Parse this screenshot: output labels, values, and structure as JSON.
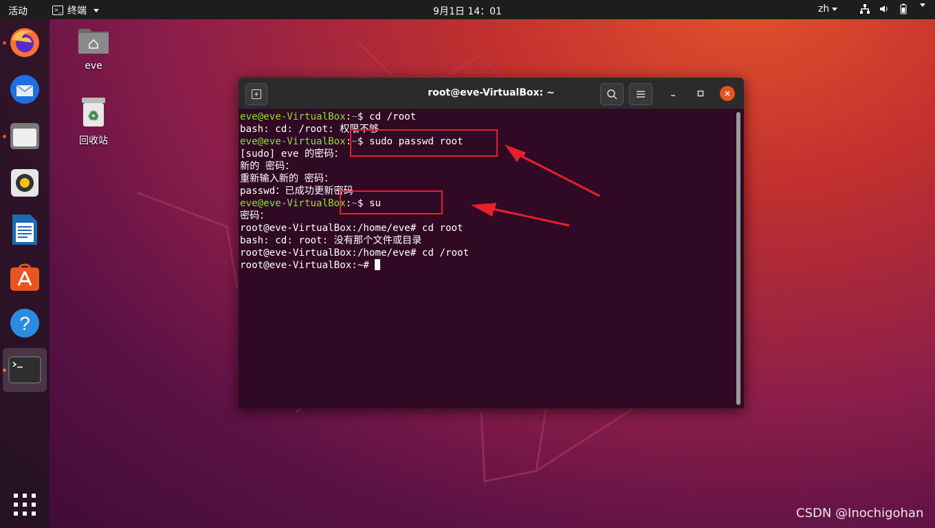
{
  "topbar": {
    "activities": "活动",
    "app_name": "终端",
    "clock": "9月1日  14：01",
    "lang": "zh"
  },
  "dock": {
    "items": [
      {
        "icon": "firefox-icon",
        "running": true
      },
      {
        "icon": "thunderbird-icon",
        "running": false
      },
      {
        "icon": "files-icon",
        "running": true
      },
      {
        "icon": "rhythmbox-icon",
        "running": false
      },
      {
        "icon": "libreoffice-writer-icon",
        "running": false
      },
      {
        "icon": "software-center-icon",
        "running": false
      },
      {
        "icon": "help-icon",
        "running": false
      },
      {
        "icon": "terminal-icon",
        "running": true
      }
    ],
    "show_apps_icon": "app-grid-icon"
  },
  "desktop": {
    "home_label": "eve",
    "trash_label": "回收站"
  },
  "terminal": {
    "title": "root@eve-VirtualBox: ~",
    "lines": [
      {
        "user": "eve@eve-VirtualBox",
        "path": "~",
        "sym": "$ ",
        "text": "cd /root"
      },
      {
        "text": "bash: cd: /root: 权限不够"
      },
      {
        "user": "eve@eve-VirtualBox",
        "path": "~",
        "sym": "$ ",
        "text": "sudo passwd root"
      },
      {
        "text": "[sudo] eve 的密码："
      },
      {
        "text": "新的 密码："
      },
      {
        "text": "重新输入新的 密码："
      },
      {
        "text": "passwd：已成功更新密码"
      },
      {
        "user": "eve@eve-VirtualBox",
        "path": "~",
        "sym": "$ ",
        "text": "su"
      },
      {
        "text": "密码："
      },
      {
        "text": "root@eve-VirtualBox:/home/eve# cd root"
      },
      {
        "text": "bash: cd: root: 没有那个文件或目录"
      },
      {
        "text": "root@eve-VirtualBox:/home/eve# cd /root"
      },
      {
        "text": "root@eve-VirtualBox:~# ",
        "cursor": true
      }
    ]
  },
  "colors": {
    "accent": "#e95420",
    "annotation": "#e8202b",
    "terminal_bg": "#300a24",
    "prompt_user": "#8ae234",
    "prompt_path": "#729fcf"
  },
  "watermark": "CSDN @Inochigohan"
}
